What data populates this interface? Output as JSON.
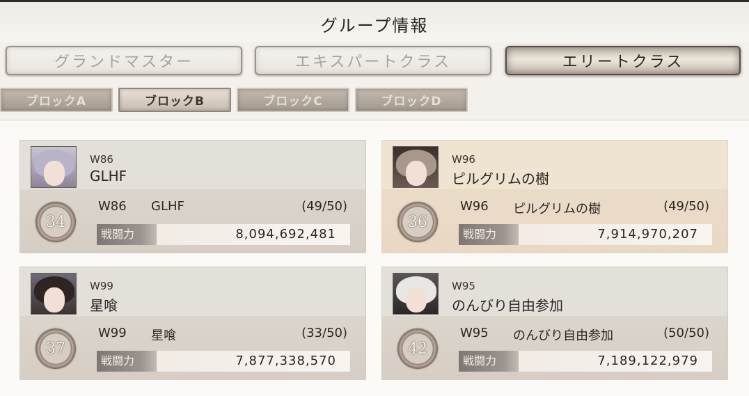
{
  "header": {
    "title": "グループ情報"
  },
  "class_tabs": [
    {
      "label": "グランドマスター",
      "active": false
    },
    {
      "label": "エキスパートクラス",
      "active": false
    },
    {
      "label": "エリートクラス",
      "active": true
    }
  ],
  "block_tabs": [
    {
      "label": "ブロックA",
      "active": false
    },
    {
      "label": "ブロックB",
      "active": true
    },
    {
      "label": "ブロックC",
      "active": false
    },
    {
      "label": "ブロックD",
      "active": false
    }
  ],
  "power_label": "戦闘力",
  "groups": [
    {
      "server": "W86",
      "name": "GLHF",
      "rank": "34",
      "members": "(49/50)",
      "power": "8,094,692,481",
      "highlighted": false
    },
    {
      "server": "W96",
      "name": "ピルグリムの樹",
      "rank": "36",
      "members": "(49/50)",
      "power": "7,914,970,207",
      "highlighted": true
    },
    {
      "server": "W99",
      "name": "星喰",
      "rank": "37",
      "members": "(33/50)",
      "power": "7,877,338,570",
      "highlighted": false
    },
    {
      "server": "W95",
      "name": "のんびり自由参加",
      "rank": "42",
      "members": "(50/50)",
      "power": "7,189,122,979",
      "highlighted": false
    }
  ]
}
